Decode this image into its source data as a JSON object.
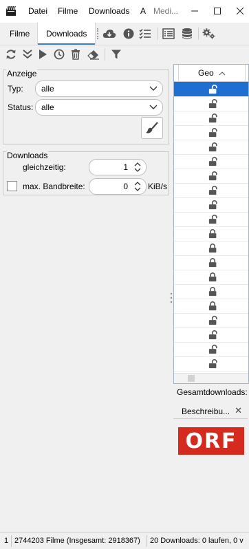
{
  "menubar": {
    "items": [
      "Datei",
      "Filme",
      "Downloads",
      "A",
      "Medi..."
    ]
  },
  "tabs": [
    "Filme",
    "Downloads"
  ],
  "active_tab": "Downloads",
  "filter_panel": {
    "title": "Anzeige",
    "typ_label": "Typ:",
    "typ_value": "alle",
    "status_label": "Status:",
    "status_value": "alle"
  },
  "downloads_panel": {
    "title": "Downloads",
    "concurrent_label": "gleichzeitig:",
    "concurrent_value": "1",
    "bandwidth_label": "max. Bandbreite:",
    "bandwidth_value": "0",
    "bandwidth_unit": "KiB/s"
  },
  "table": {
    "column": "Geo",
    "rows": [
      {
        "locked": false,
        "selected": true
      },
      {
        "locked": false
      },
      {
        "locked": false
      },
      {
        "locked": false
      },
      {
        "locked": false
      },
      {
        "locked": false
      },
      {
        "locked": false
      },
      {
        "locked": false
      },
      {
        "locked": false
      },
      {
        "locked": false
      },
      {
        "locked": true
      },
      {
        "locked": true
      },
      {
        "locked": true
      },
      {
        "locked": true
      },
      {
        "locked": true
      },
      {
        "locked": true
      },
      {
        "locked": false
      },
      {
        "locked": false
      },
      {
        "locked": false
      },
      {
        "locked": false
      }
    ]
  },
  "total_label": "Gesamtdownloads:",
  "description_tab": "Beschreibu...",
  "logo_text": "ORF",
  "status": {
    "count": "1",
    "films": "2744203 Filme (Insgesamt: 2918367)",
    "downloads": "20 Downloads: 0 laufen, 0 v"
  },
  "colors": {
    "accent": "#3d7fc2",
    "selection": "#1f6fd1",
    "orf_red": "#d52b1e"
  }
}
